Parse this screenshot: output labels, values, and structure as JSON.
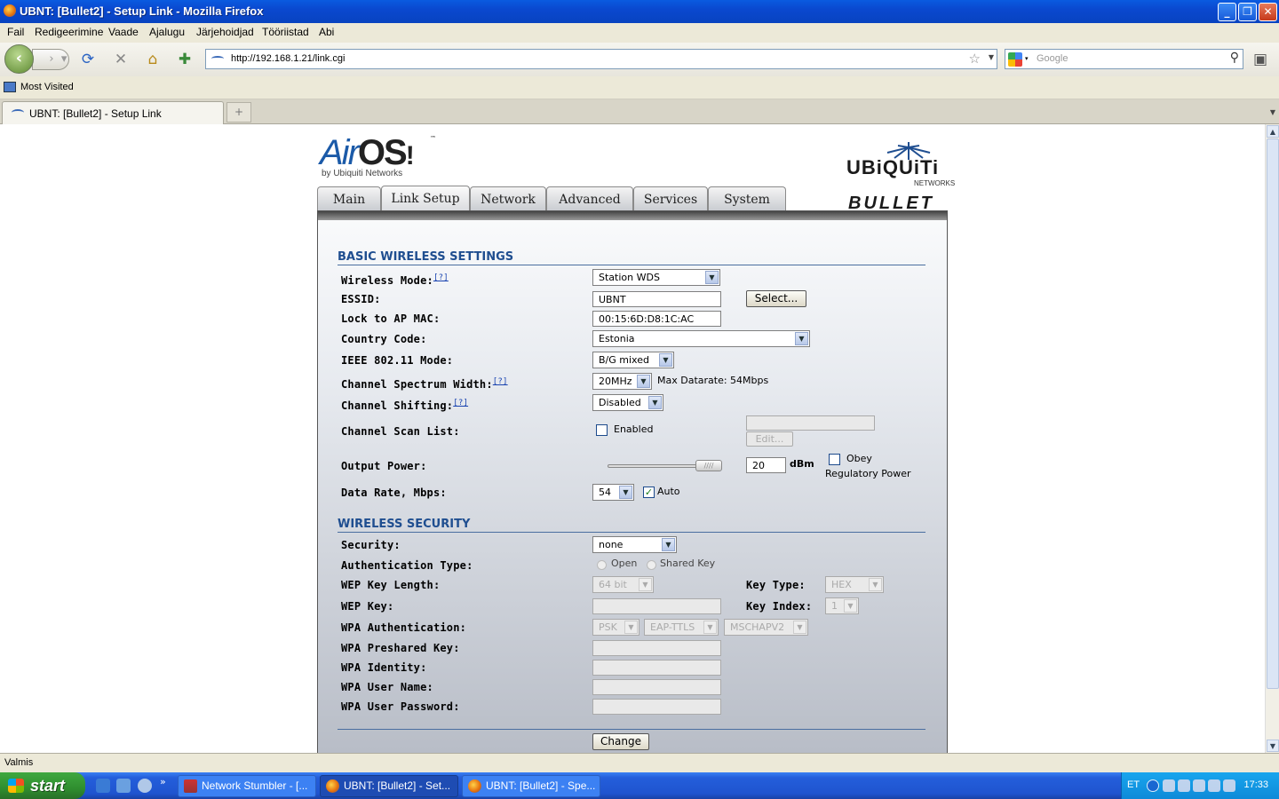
{
  "window": {
    "title": "UBNT: [Bullet2] - Setup Link - Mozilla Firefox"
  },
  "menu": [
    "Fail",
    "Redigeerimine",
    "Vaade",
    "Ajalugu",
    "Järjehoidjad",
    "Tööriistad",
    "Abi"
  ],
  "nav": {
    "url": "http://192.168.1.21/link.cgi",
    "search_placeholder": "Google"
  },
  "bookmarks": {
    "most_visited": "Most Visited"
  },
  "tabbar": {
    "tab_title": "UBNT: [Bullet2] - Setup Link"
  },
  "status": {
    "text": "Valmis"
  },
  "taskbar": {
    "start": "start",
    "tasks": [
      "Network Stumbler - [...",
      "UBNT: [Bullet2] - Set...",
      "UBNT: [Bullet2] - Spe..."
    ],
    "lang": "ET",
    "clock": "17:33"
  },
  "logo": {
    "airos": "Air",
    "airos_os": "OS",
    "airos_by": "by Ubiquiti Networks",
    "tm": "™",
    "ubiquiti": "UBiQUiTi",
    "networks": "NETWORKS",
    "bullet": "BULLET"
  },
  "tabs": [
    "Main",
    "Link Setup",
    "Network",
    "Advanced",
    "Services",
    "System"
  ],
  "basic": {
    "title": "BASIC WIRELESS SETTINGS",
    "help": "[?]",
    "wireless_mode_label": "Wireless Mode:",
    "wireless_mode": "Station WDS",
    "essid_label": "ESSID:",
    "essid": "UBNT",
    "select_btn": "Select...",
    "lock_label": "Lock to AP MAC:",
    "lock_mac": "00:15:6D:D8:1C:AC",
    "country_label": "Country Code:",
    "country": "Estonia",
    "ieee_label": "IEEE 802.11 Mode:",
    "ieee": "B/G mixed",
    "spectrum_label": "Channel Spectrum Width:",
    "spectrum": "20MHz",
    "max_datarate": "Max Datarate: 54Mbps",
    "shifting_label": "Channel Shifting:",
    "shifting": "Disabled",
    "scan_label": "Channel Scan List:",
    "scan_enabled": "Enabled",
    "edit_btn": "Edit...",
    "power_label": "Output Power:",
    "power_value": "20",
    "power_unit": "dBm",
    "power_level": 1.0,
    "obey": "Obey",
    "regulatory": "Regulatory Power",
    "rate_label": "Data Rate, Mbps:",
    "rate": "54",
    "auto": "Auto"
  },
  "security": {
    "title": "WIRELESS SECURITY",
    "security_label": "Security:",
    "security": "none",
    "auth_label": "Authentication Type:",
    "open": "Open",
    "shared": "Shared Key",
    "wep_len_label": "WEP Key Length:",
    "wep_len": "64 bit",
    "key_type_label": "Key Type:",
    "key_type": "HEX",
    "wep_key_label": "WEP Key:",
    "key_index_label": "Key Index:",
    "key_index": "1",
    "wpa_auth_label": "WPA Authentication:",
    "wpa_psk": "PSK",
    "wpa_eap": "EAP-TTLS",
    "wpa_mschap": "MSCHAPV2",
    "wpa_psk_key_label": "WPA Preshared Key:",
    "wpa_identity_label": "WPA Identity:",
    "wpa_user_label": "WPA User Name:",
    "wpa_pass_label": "WPA User Password:",
    "change_btn": "Change"
  }
}
